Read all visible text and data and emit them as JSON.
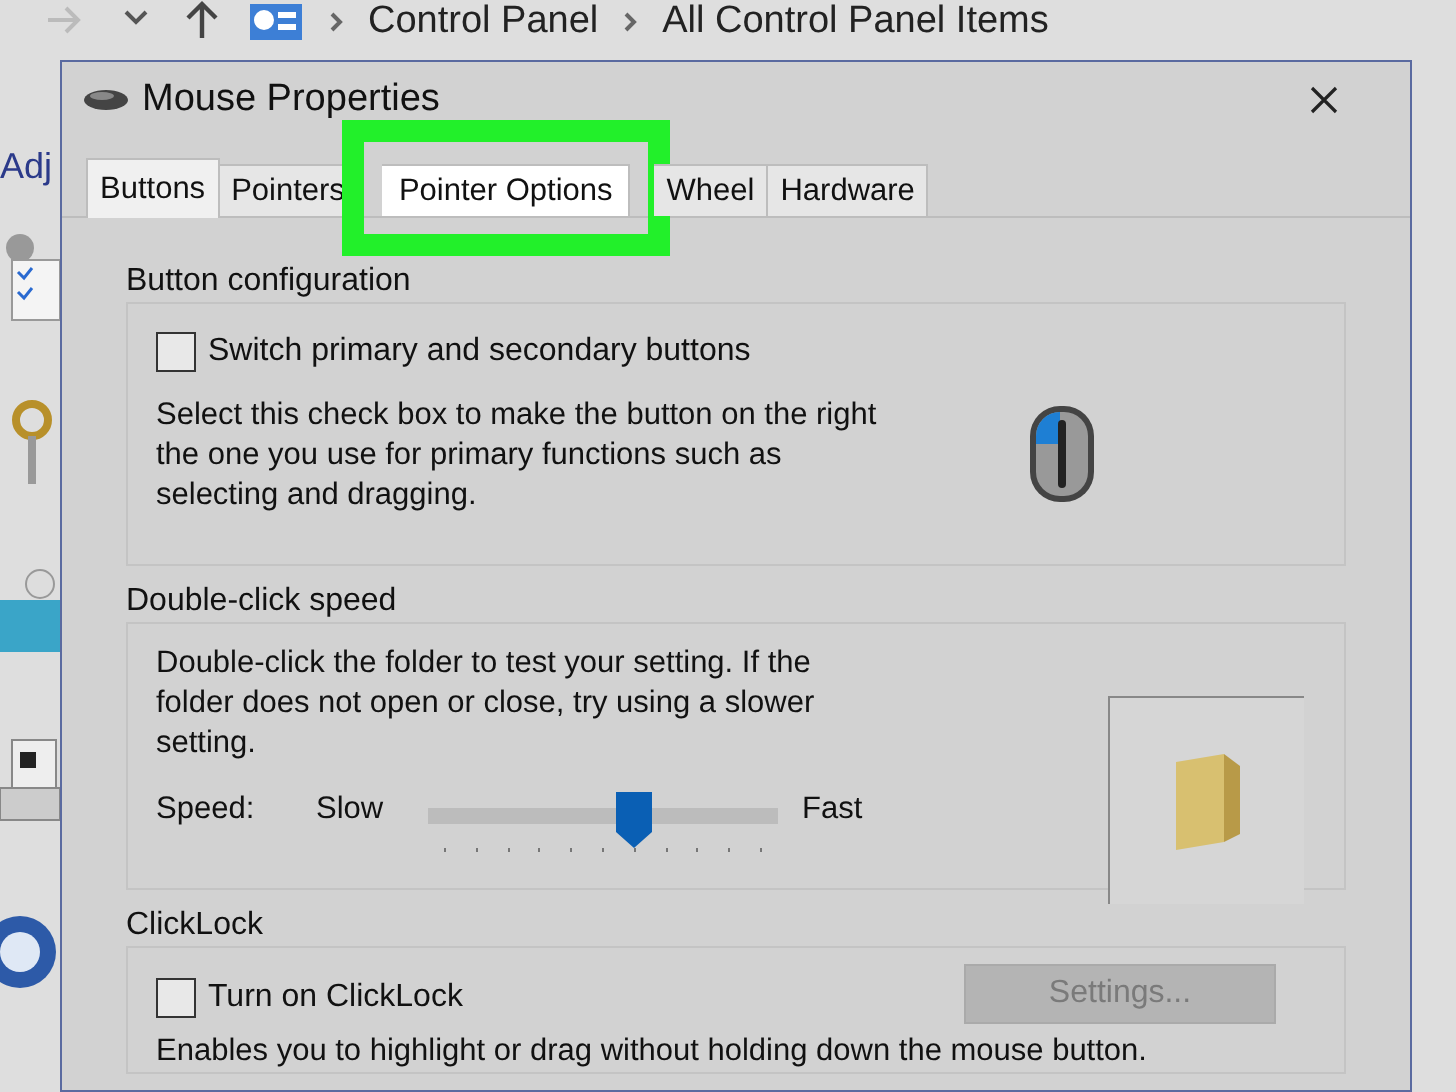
{
  "explorer": {
    "breadcrumb": [
      "Control Panel",
      "All Control Panel Items"
    ],
    "side_heading": "Adj"
  },
  "window": {
    "title": "Mouse Properties"
  },
  "tabs": [
    {
      "label": "Buttons",
      "selected": true,
      "highlighted": false
    },
    {
      "label": "Pointers",
      "selected": false,
      "highlighted": false
    },
    {
      "label": "Pointer Options",
      "selected": false,
      "highlighted": true
    },
    {
      "label": "Wheel",
      "selected": false,
      "highlighted": false
    },
    {
      "label": "Hardware",
      "selected": false,
      "highlighted": false
    }
  ],
  "groups": [
    {
      "kind": "buttons",
      "title": "Button configuration",
      "checkbox": {
        "label": "Switch primary and secondary buttons",
        "checked": false
      },
      "description": "Select this check box to make the button on the right the one you use for primary functions such as selecting and dragging."
    },
    {
      "kind": "speed",
      "title": "Double-click speed",
      "description": "Double-click the folder to test your setting. If the folder does not open or close, try using a slower setting.",
      "slider": {
        "label": "Speed:",
        "min_label": "Slow",
        "max_label": "Fast",
        "level": 0.59
      }
    },
    {
      "kind": "clicklock",
      "title": "ClickLock",
      "checkbox": {
        "label": "Turn on ClickLock",
        "checked": false
      },
      "button": {
        "label": "Settings...",
        "disabled": true
      },
      "description": "Enables you to highlight or drag without holding down the mouse button."
    }
  ]
}
